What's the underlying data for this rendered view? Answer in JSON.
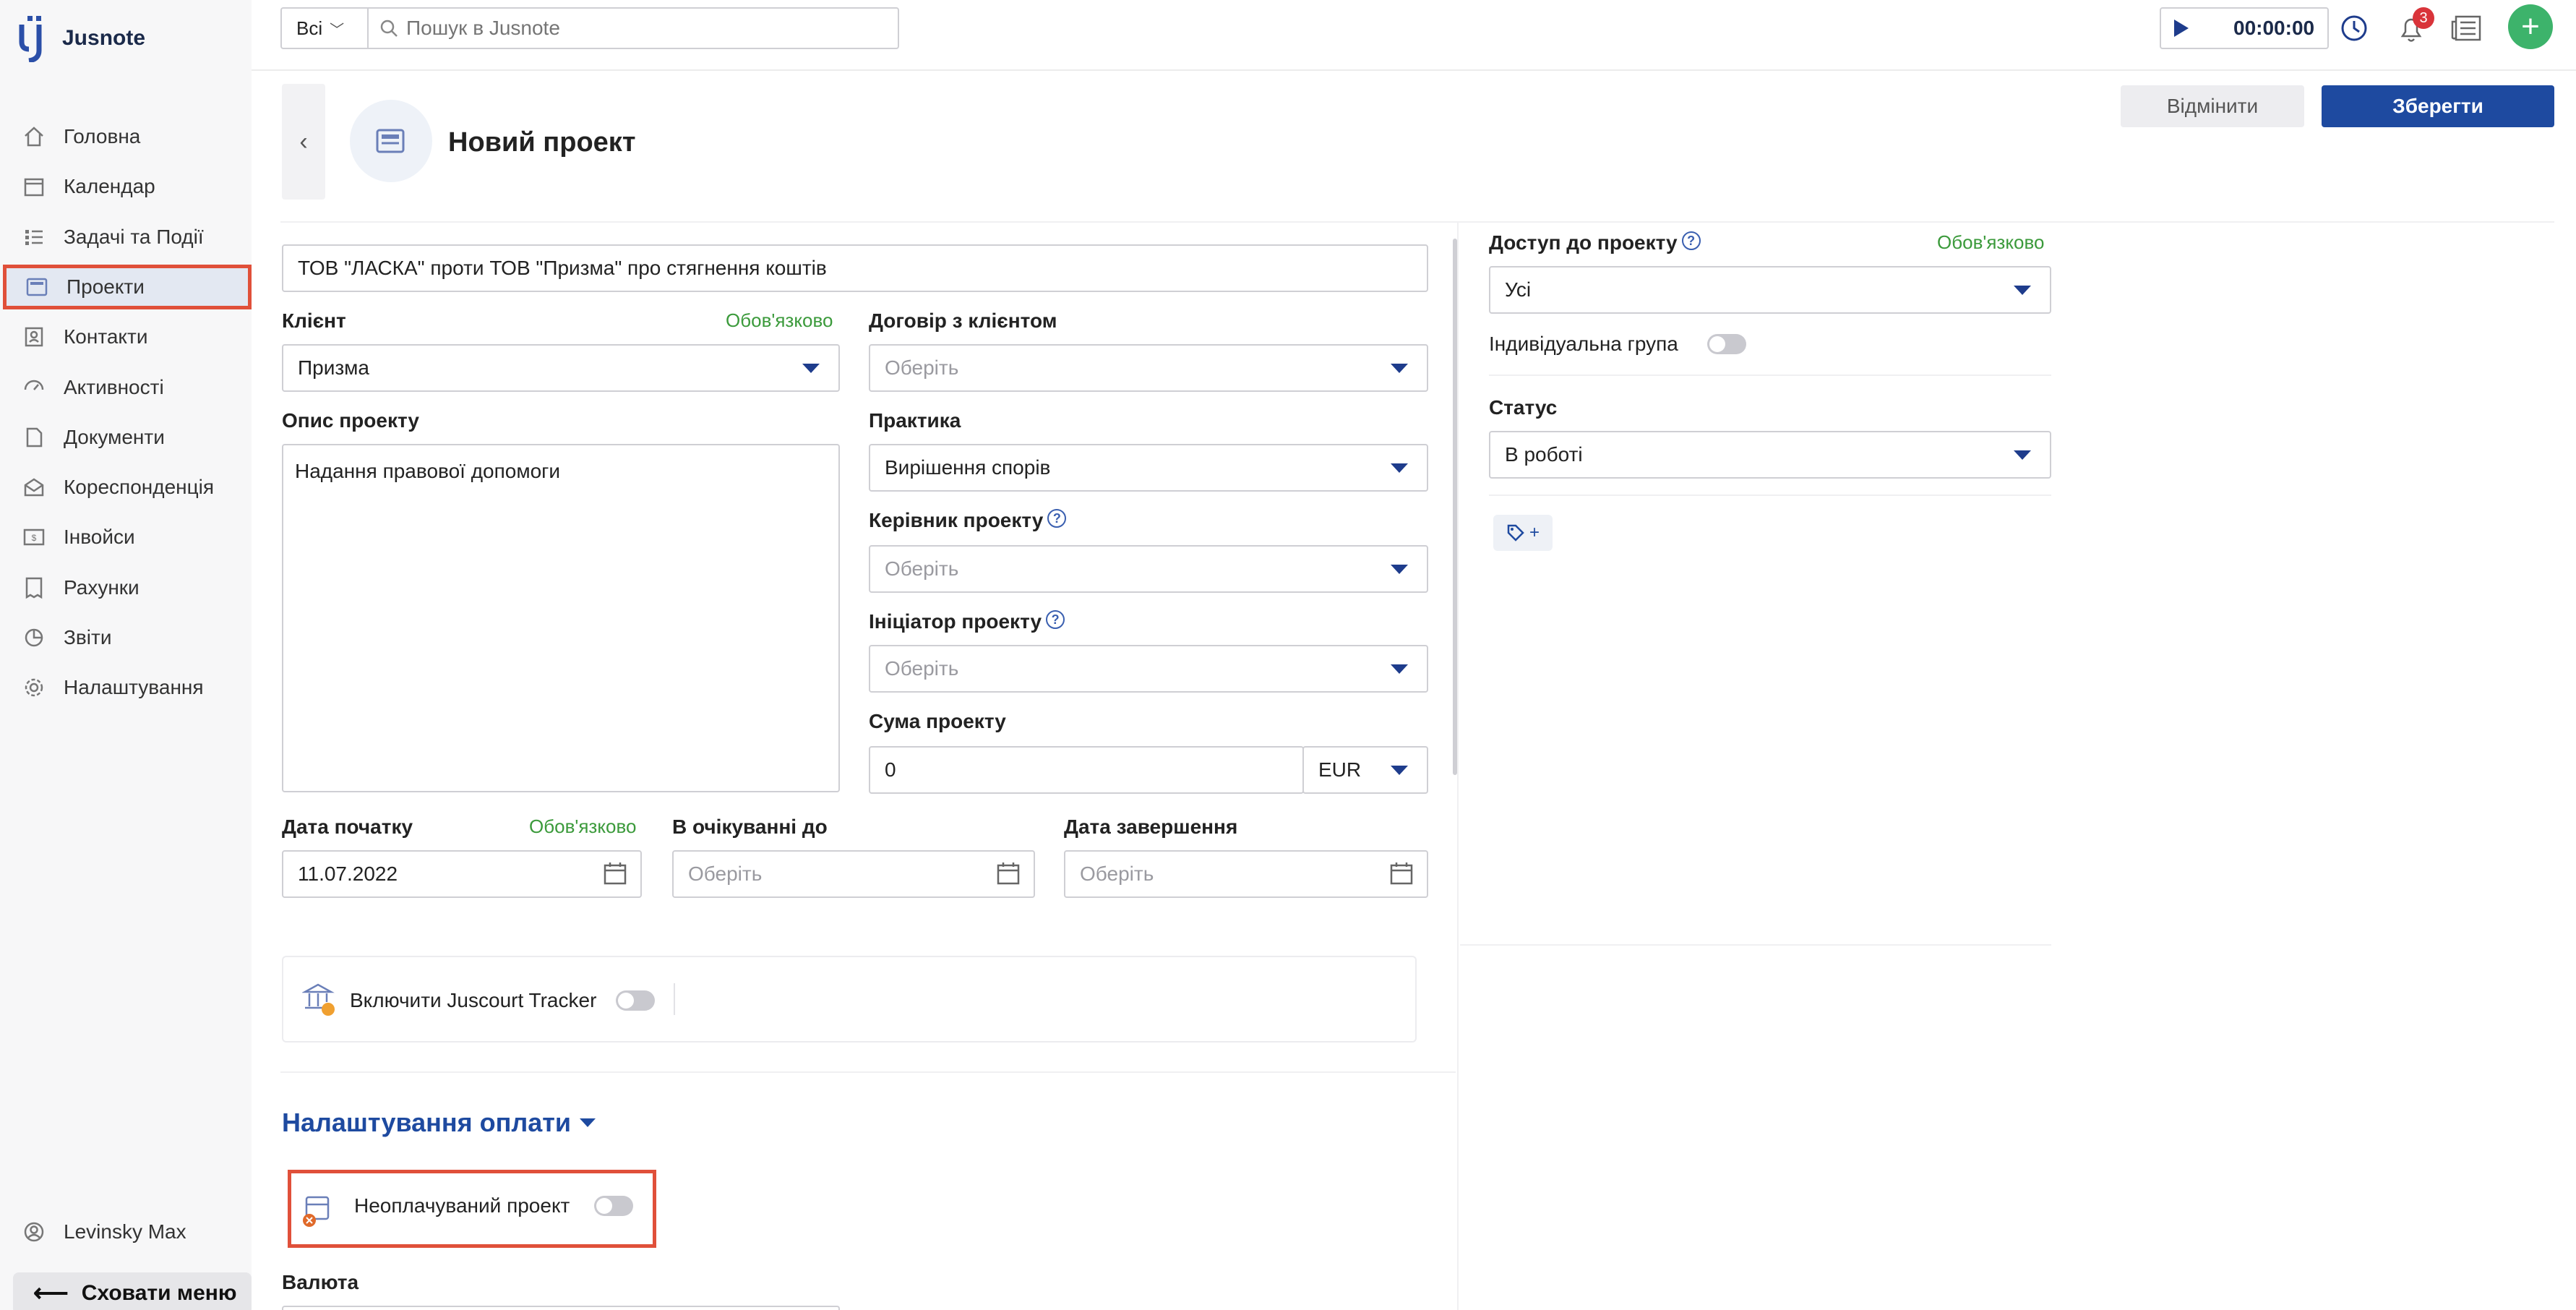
{
  "app": {
    "name": "Jusnote"
  },
  "sidebar": {
    "items": [
      {
        "label": "Головна",
        "icon": "home-icon"
      },
      {
        "label": "Календар",
        "icon": "calendar-icon"
      },
      {
        "label": "Задачі та Події",
        "icon": "tasks-icon"
      },
      {
        "label": "Проекти",
        "icon": "projects-icon",
        "active": true
      },
      {
        "label": "Контакти",
        "icon": "contacts-icon"
      },
      {
        "label": "Активності",
        "icon": "activity-icon"
      },
      {
        "label": "Документи",
        "icon": "documents-icon"
      },
      {
        "label": "Кореспонденція",
        "icon": "mail-icon"
      },
      {
        "label": "Інвойси",
        "icon": "invoice-icon"
      },
      {
        "label": "Рахунки",
        "icon": "bills-icon"
      },
      {
        "label": "Звіти",
        "icon": "reports-icon"
      },
      {
        "label": "Налаштування",
        "icon": "gear-icon"
      }
    ],
    "user": "Levinsky Max",
    "hide_menu": "Сховати меню"
  },
  "topbar": {
    "scope": "Всі",
    "search_placeholder": "Пошук в Jusnote",
    "timer": "00:00:00",
    "notifications_count": "3"
  },
  "header": {
    "title": "Новий проект",
    "cancel_label": "Відмінити",
    "save_label": "Зберегти"
  },
  "form": {
    "project_name": "ТОВ \"ЛАСКА\" проти ТОВ \"Призма\" про стягнення коштів",
    "client_label": "Клієнт",
    "client_value": "Призма",
    "required": "Обов'язково",
    "contract_label": "Договір з клієнтом",
    "select_placeholder": "Оберіть",
    "description_label": "Опис проекту",
    "description_value": "Надання правової допомоги",
    "practice_label": "Практика",
    "practice_value": "Вирішення спорів",
    "manager_label": "Керівник проекту",
    "initiator_label": "Ініціатор проекту",
    "sum_label": "Сума проекту",
    "sum_value": "0",
    "currency_value": "EUR",
    "start_date_label": "Дата початку",
    "start_date_value": "11.07.2022",
    "pending_label": "В очікуванні до",
    "end_date_label": "Дата завершення",
    "juscourt_label": "Включити Juscourt Tracker",
    "payment_settings": "Налаштування оплати",
    "unpaid_label": "Неоплачуваний проект",
    "currency_label": "Валюта"
  },
  "right": {
    "access_label": "Доступ до проекту",
    "access_value": "Усі",
    "individual_group": "Індивідуальна група",
    "status_label": "Статус",
    "status_value": "В роботі",
    "tag_add": "+"
  },
  "colors": {
    "accent": "#1e4aa0",
    "highlight": "#e0503a",
    "required": "#3b9a3b",
    "add": "#3db36b"
  }
}
